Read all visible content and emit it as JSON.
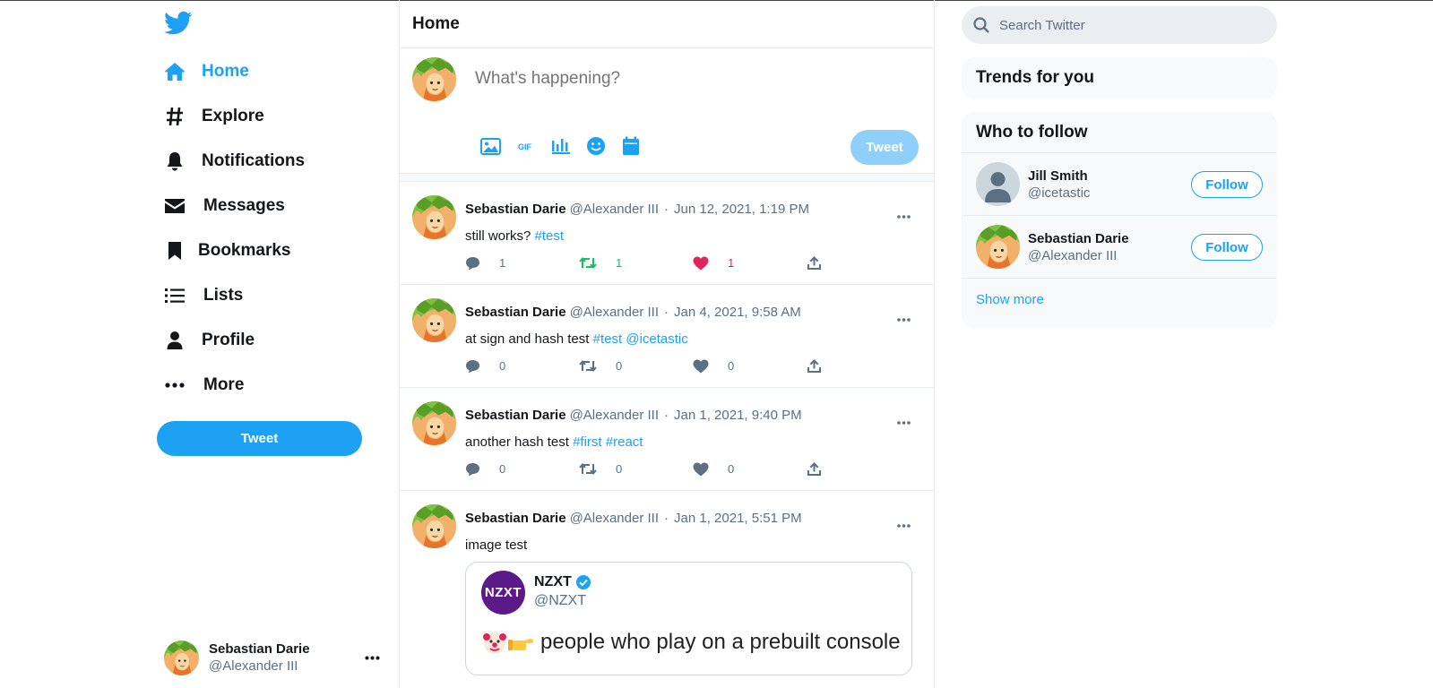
{
  "colors": {
    "accent": "#1da1f2",
    "retweet": "#17bf63",
    "like": "#e0245e",
    "muted": "#5b7083"
  },
  "sidebar": {
    "items": [
      {
        "label": "Home",
        "icon": "home-icon",
        "active": true
      },
      {
        "label": "Explore",
        "icon": "hash-icon"
      },
      {
        "label": "Notifications",
        "icon": "bell-icon"
      },
      {
        "label": "Messages",
        "icon": "envelope-icon"
      },
      {
        "label": "Bookmarks",
        "icon": "bookmark-icon"
      },
      {
        "label": "Lists",
        "icon": "list-icon"
      },
      {
        "label": "Profile",
        "icon": "person-icon"
      },
      {
        "label": "More",
        "icon": "more-dots-icon"
      }
    ],
    "tweet_button": "Tweet",
    "account": {
      "name": "Sebastian Darie",
      "handle": "@Alexander III"
    }
  },
  "main": {
    "title": "Home",
    "composer": {
      "placeholder": "What's happening?",
      "tools": [
        "image-icon",
        "gif-icon",
        "poll-icon",
        "emoji-icon",
        "schedule-icon"
      ],
      "tweet_button": "Tweet"
    },
    "tweets": [
      {
        "name": "Sebastian Darie",
        "handle": "@Alexander III",
        "date": "Jun 12, 2021, 1:19 PM",
        "text": "still works?",
        "tags": [
          "#test"
        ],
        "replies": "1",
        "retweets": "1",
        "likes": "1",
        "retweeted": true,
        "liked": true
      },
      {
        "name": "Sebastian Darie",
        "handle": "@Alexander III",
        "date": "Jan 4, 2021, 9:58 AM",
        "text": "at sign and hash test",
        "tags": [
          "#test",
          "@icetastic"
        ],
        "replies": "0",
        "retweets": "0",
        "likes": "0"
      },
      {
        "name": "Sebastian Darie",
        "handle": "@Alexander III",
        "date": "Jan 1, 2021, 9:40 PM",
        "text": "another hash test",
        "tags": [
          "#first",
          "#react"
        ],
        "replies": "0",
        "retweets": "0",
        "likes": "0"
      },
      {
        "name": "Sebastian Darie",
        "handle": "@Alexander III",
        "date": "Jan 1, 2021, 5:51 PM",
        "text": "image test",
        "tags": [],
        "quote": {
          "avatar_text": "NZXT",
          "name": "NZXT",
          "handle": "@NZXT",
          "text": "people who play on a prebuilt console"
        }
      }
    ]
  },
  "right": {
    "search_placeholder": "Search Twitter",
    "trends_title": "Trends for you",
    "who_title": "Who to follow",
    "follow": [
      {
        "name": "Jill Smith",
        "handle": "@icetastic",
        "button": "Follow",
        "avatar": "default"
      },
      {
        "name": "Sebastian Darie",
        "handle": "@Alexander III",
        "button": "Follow",
        "avatar": "character"
      }
    ],
    "show_more": "Show more"
  }
}
